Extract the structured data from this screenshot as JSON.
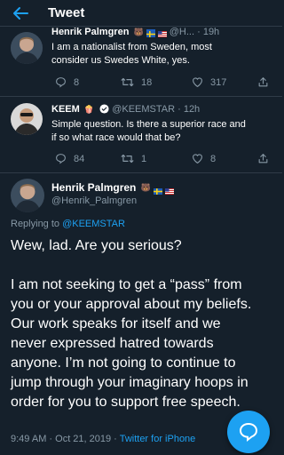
{
  "header": {
    "title": "Tweet"
  },
  "tweet1": {
    "name": "Henrik Palmgren",
    "handle_time": "@H... · 19h",
    "text_line1": "I am a nationalist from Sweden, most",
    "text_line2": "consider us Swedes White, yes.",
    "replies": "8",
    "retweets": "18",
    "likes": "317"
  },
  "tweet2": {
    "name": "KEEM",
    "handle_time": "@KEEMSTAR · 12h",
    "text_line1": "Simple question. Is there a superior race and",
    "text_line2": "if so what race would that be?",
    "replies": "84",
    "retweets": "1",
    "likes": "8"
  },
  "main_tweet": {
    "name": "Henrik Palmgren",
    "handle": "@Henrik_Palmgren",
    "replying_prefix": "Replying to ",
    "replying_handle": "@KEEMSTAR",
    "line1": "Wew, lad. Are you serious?",
    "para_lines": [
      "I am not seeking to get a “pass” from",
      "you or your approval about my beliefs.",
      "Our work speaks for itself and we",
      "never expressed hatred towards",
      "anyone. I’m not going to continue to",
      "jump through your imaginary hoops in",
      "order for you to support free speech."
    ],
    "timestamp": "9:49 AM · Oct 21, 2019 · ",
    "source": "Twitter for iPhone"
  },
  "icons": [
    "back-arrow-icon",
    "reply-icon",
    "retweet-icon",
    "like-icon",
    "share-icon",
    "verified-icon",
    "compose-reply-icon"
  ],
  "colors": {
    "background": "#15202b",
    "accent": "#1da1f2",
    "muted": "#8899a6",
    "divider": "#2f3b47"
  }
}
